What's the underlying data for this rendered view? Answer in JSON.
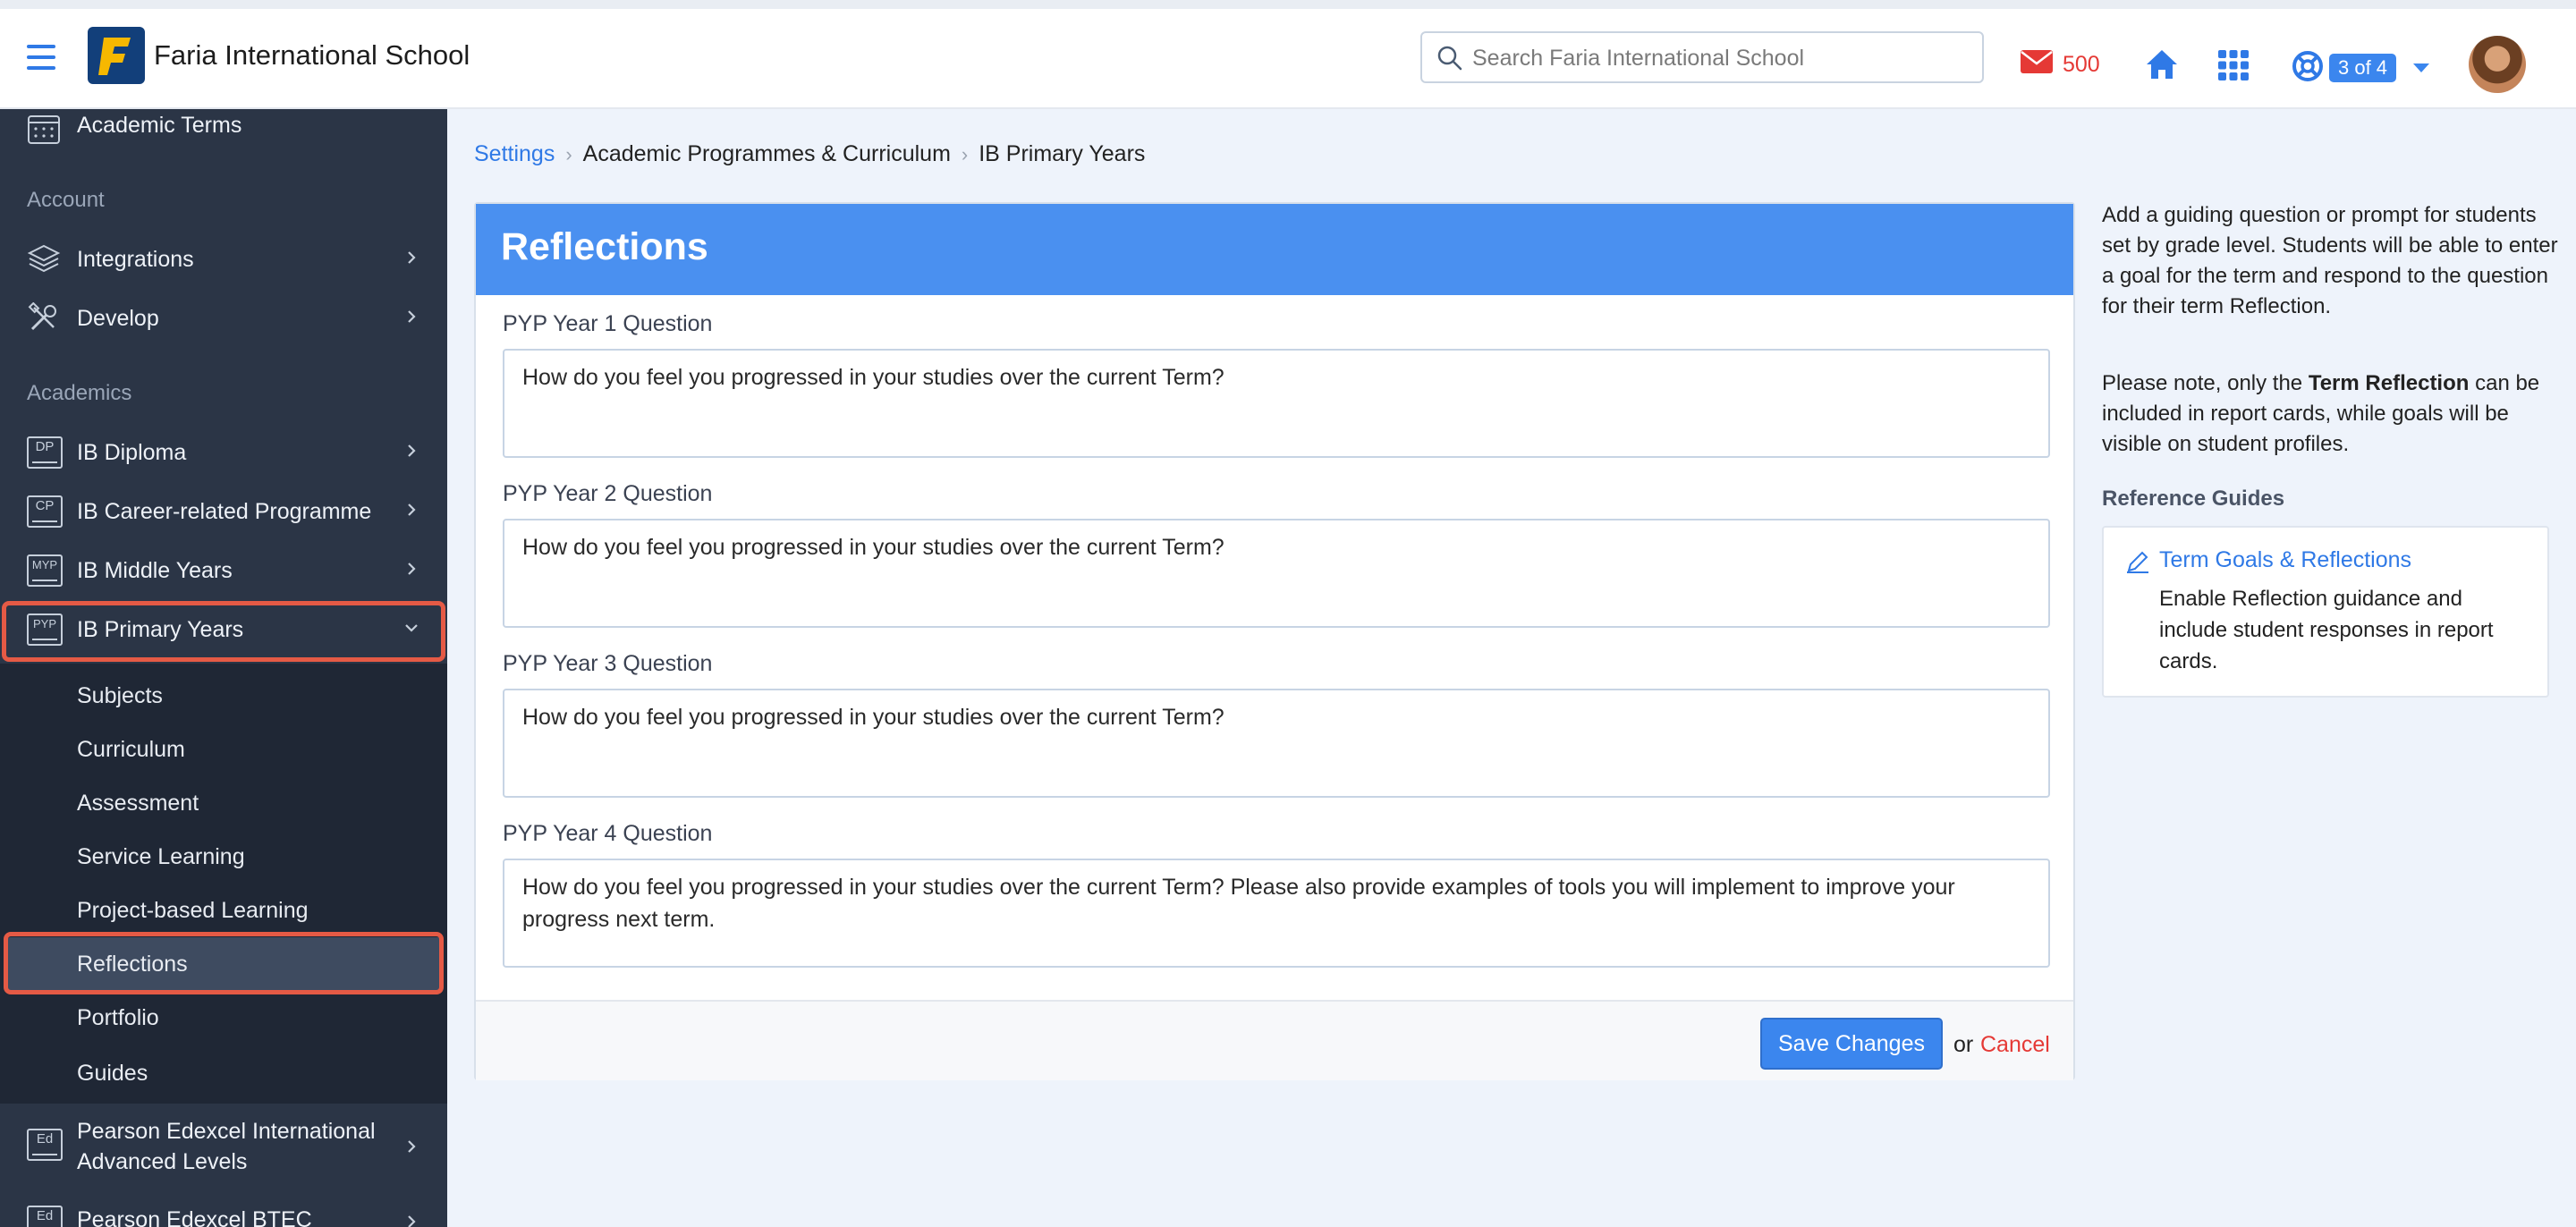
{
  "topbar": {
    "school_name": "Faria International School",
    "search_placeholder": "Search Faria International School",
    "mail_count": "500",
    "help_badge": "3 of 4"
  },
  "sidebar": {
    "top_item": "Academic Terms",
    "account_heading": "Account",
    "account_items": [
      "Integrations",
      "Develop"
    ],
    "academics_heading": "Academics",
    "programmes": [
      {
        "badge": "DP",
        "label": "IB Diploma"
      },
      {
        "badge": "CP",
        "label": "IB Career-related Programme"
      },
      {
        "badge": "MYP",
        "label": "IB Middle Years"
      },
      {
        "badge": "PYP",
        "label": "IB Primary Years"
      }
    ],
    "pyp_subitems": [
      "Subjects",
      "Curriculum",
      "Assessment",
      "Service Learning",
      "Project-based Learning",
      "Reflections",
      "Portfolio",
      "Guides"
    ],
    "bottom_items": [
      {
        "badge": "Ed",
        "line1": "Pearson Edexcel International",
        "line2": "Advanced Levels"
      },
      {
        "badge": "Ed",
        "line1": "Pearson Edexcel BTEC",
        "line2": ""
      }
    ]
  },
  "breadcrumb": {
    "settings": "Settings",
    "programmes": "Academic Programmes & Curriculum",
    "current": "IB Primary Years"
  },
  "main": {
    "title": "Reflections",
    "questions": [
      {
        "label": "PYP Year 1 Question",
        "value": "How do you feel you progressed in your studies over the current Term?"
      },
      {
        "label": "PYP Year 2 Question",
        "value": "How do you feel you progressed in your studies over the current Term?"
      },
      {
        "label": "PYP Year 3 Question",
        "value": "How do you feel you progressed in your studies over the current Term?"
      },
      {
        "label": "PYP Year 4 Question",
        "value": "How do you feel you progressed in your studies over the current Term? Please also provide examples of tools you will implement to improve your progress next term."
      }
    ],
    "save_label": "Save Changes",
    "or_text": "or",
    "cancel_label": "Cancel"
  },
  "help": {
    "intro": "Add a guiding question or prompt for students set by grade level. Students will be able to enter a goal for the term and respond to the question for their term Reflection.",
    "note_before": "Please note, only the ",
    "note_bold": "Term Reflection",
    "note_after": " can be included in report cards, while goals will be visible on student profiles.",
    "reference_heading": "Reference Guides",
    "guide_link": "Term Goals & Reflections",
    "guide_desc": "Enable Reflection guidance and include student responses in report cards."
  },
  "colors": {
    "accent": "#4a90f0",
    "link": "#2f79e6",
    "sidebar_bg": "#2b3546",
    "highlight": "#e55a45",
    "danger": "#e53935"
  }
}
